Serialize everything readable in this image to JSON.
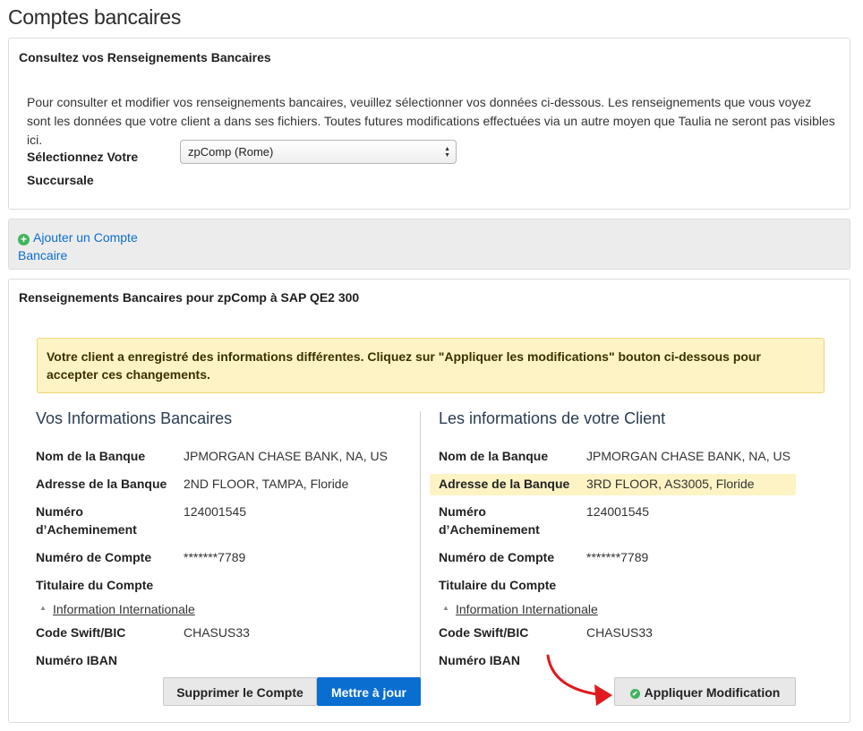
{
  "page": {
    "title": "Comptes bancaires"
  },
  "consult": {
    "title": "Consultez vos Renseignements Bancaires",
    "intro": "Pour consulter et modifier vos renseignements bancaires, veuillez sélectionner vos données ci-dessous. Les renseignements que vous voyez sont les données que votre client a dans ses fichiers. Toutes futures modifications effectuées via un autre moyen que Taulia ne seront pas visibles ici.",
    "branch_label": "Sélectionnez Votre Succursale",
    "branch_value": "zpComp (Rome)"
  },
  "add_account": {
    "label": "Ajouter un Compte Bancaire"
  },
  "details": {
    "title": "Renseignements Bancaires pour zpComp à SAP QE2 300",
    "alert": "Votre client a enregistré des informations différentes. Cliquez sur \"Appliquer les modifications\" bouton ci-dessous pour accepter ces changements.",
    "left": {
      "title": "Vos Informations Bancaires",
      "fields": [
        {
          "label": "Nom de la Banque",
          "value": "JPMORGAN CHASE BANK, NA, US"
        },
        {
          "label": "Adresse de la Banque",
          "value": "2ND FLOOR, TAMPA, Floride"
        },
        {
          "label": "Numéro d’Acheminement",
          "value": "124001545"
        },
        {
          "label": "Numéro de Compte",
          "value": "*******7789"
        },
        {
          "label": "Titulaire du Compte",
          "value": ""
        }
      ],
      "intl_label": "Information Internationale",
      "intl_fields": [
        {
          "label": "Code Swift/BIC",
          "value": "CHASUS33"
        },
        {
          "label": "Numéro IBAN",
          "value": ""
        }
      ],
      "delete_label": "Supprimer le Compte",
      "update_label": "Mettre à jour"
    },
    "right": {
      "title": "Les informations de votre Client",
      "fields": [
        {
          "label": "Nom de la Banque",
          "value": "JPMORGAN CHASE BANK, NA, US"
        },
        {
          "label": "Adresse de la Banque",
          "value": "3RD FLOOR, AS3005, Floride"
        },
        {
          "label": "Numéro d’Acheminement",
          "value": "124001545"
        },
        {
          "label": "Numéro de Compte",
          "value": "*******7789"
        },
        {
          "label": "Titulaire du Compte",
          "value": ""
        }
      ],
      "intl_label": "Information Internationale",
      "intl_fields": [
        {
          "label": "Code Swift/BIC",
          "value": "CHASUS33"
        },
        {
          "label": "Numéro IBAN",
          "value": ""
        }
      ],
      "apply_label": "Appliquer Modification"
    }
  },
  "colors": {
    "accent": "#0a6ed1",
    "highlight": "#fdf3c4",
    "success": "#3eb55f",
    "annotation_arrow": "#e0191e"
  }
}
